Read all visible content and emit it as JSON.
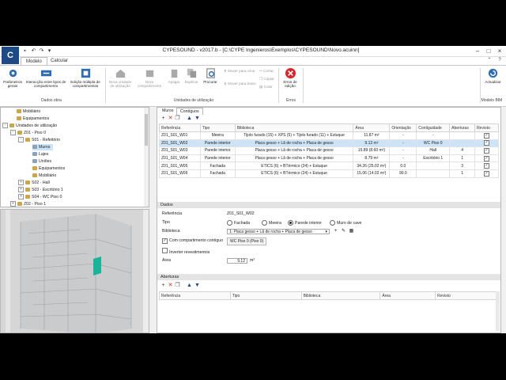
{
  "window": {
    "title": "CYPESOUND - v2017.b - [C:\\CYPE Ingenieros\\Exemplos\\CYPESOUND\\Novo.acuinn]",
    "logo": "C"
  },
  "ribbon_tabs": [
    "Modelo",
    "Calcular"
  ],
  "ribbon": {
    "groups": {
      "dados_obra": {
        "label": "Dados obra",
        "buttons": [
          {
            "label": "Parâmetros gerais",
            "icon": "gear-icon"
          },
          {
            "label": "Interacção entre tipos de compartimento",
            "icon": "arrows-icon"
          },
          {
            "label": "Edição múltipla de compartimentos",
            "icon": "multi-edit-icon"
          }
        ]
      },
      "unidades_utilizacao": {
        "label": "Unidades de utilização",
        "buttons": [
          {
            "label": "Nova unidade de utilização",
            "icon": "house-icon"
          },
          {
            "label": "Novo compartimento",
            "icon": "room-icon"
          },
          {
            "label": "Apagar",
            "icon": "delete-icon"
          },
          {
            "label": "Duplicar",
            "icon": "duplicate-icon"
          },
          {
            "label": "Procurar",
            "icon": "search-icon"
          }
        ],
        "small": [
          "Mover para cima",
          "Mover para baixo",
          "Cortar",
          "Copiar",
          "Colar"
        ]
      },
      "erros": {
        "label": "Erros",
        "buttons": [
          {
            "label": "Erros de edição",
            "icon": "error-icon"
          }
        ]
      },
      "modelo_bim": {
        "label": "Modelo BIM",
        "buttons": [
          {
            "label": "Actualizar",
            "icon": "refresh-icon"
          }
        ]
      }
    }
  },
  "tree": {
    "nodes": [
      {
        "label": "Mobiliário"
      },
      {
        "label": "Equipamentos"
      },
      {
        "label": "Unidades de utilização"
      },
      {
        "label": "Z01 - Piso 0"
      },
      {
        "label": "S01 - Refeitório"
      },
      {
        "label": "Muros"
      },
      {
        "label": "Lajes"
      },
      {
        "label": "Uniões"
      },
      {
        "label": "Equipamentos"
      },
      {
        "label": "Mobiliário"
      },
      {
        "label": "S02 - Hall"
      },
      {
        "label": "S03 - Escritório 1"
      },
      {
        "label": "S04 - WC Piso 0"
      },
      {
        "label": "Z02 - Piso 1"
      }
    ]
  },
  "panel_tabs": [
    "Muros",
    "Contíguos"
  ],
  "walls_table": {
    "headers": [
      "Referência",
      "Tipo",
      "Biblioteca",
      "Área",
      "Orientação",
      "Contiguidade",
      "Aberturas",
      "Revisto"
    ],
    "rows": [
      {
        "ref": "Z01_S01_W01",
        "tipo": "Meeira",
        "biblioteca": "Tijolo furado (15) + XPS (5) + Tijolo furado (11) + Estuque",
        "area": "11.87 m²",
        "orientacao": "-",
        "contiguidade": "-",
        "aberturas": "",
        "revisto": "✓"
      },
      {
        "ref": "Z01_S01_W02",
        "tipo": "Parede interior",
        "biblioteca": "Placa gesso + Lã de rocha + Placa de gesso",
        "area": "9.12 m²",
        "orientacao": "-",
        "contiguidade": "WC Piso 0",
        "aberturas": "",
        "revisto": "✓"
      },
      {
        "ref": "Z01_S01_W03",
        "tipo": "Parede interior",
        "biblioteca": "Placa gesso + Lã de rocha + Placa de gesso",
        "area": "15.89 (8.60 m²)",
        "orientacao": "-",
        "contiguidade": "Hall",
        "aberturas": "4",
        "revisto": "✓"
      },
      {
        "ref": "Z01_S01_W04",
        "tipo": "Parede interior",
        "biblioteca": "Placa gesso + Lã de rocha + Placa de gesso",
        "area": "8.79 m²",
        "orientacao": "-",
        "contiguidade": "Escritório 1",
        "aberturas": "1",
        "revisto": "✓"
      },
      {
        "ref": "Z01_S01_W05",
        "tipo": "Fachada",
        "biblioteca": "ETICS (6) + BTérmico (24) + Estuque",
        "area": "34.26 (25.02 m²)",
        "orientacao": "0.0",
        "contiguidade": "",
        "aberturas": "3",
        "revisto": "✓"
      },
      {
        "ref": "Z01_S01_W06",
        "tipo": "Fachada",
        "biblioteca": "ETICS (6) + BTérmico (24) + Estuque",
        "area": "15.06 (14.02 m²)",
        "orientacao": "90.0",
        "contiguidade": "",
        "aberturas": "1",
        "revisto": "✓"
      }
    ]
  },
  "dados": {
    "title": "Dados",
    "referencia_label": "Referência",
    "referencia_value": "Z01_S01_W02",
    "tipo_label": "Tipo",
    "tipo_options": [
      "Fachada",
      "Meeira",
      "Parede interior",
      "Muro de cave"
    ],
    "tipo_selected": "Parede interior",
    "biblioteca_label": "Biblioteca",
    "biblioteca_value": "1: Placa gesso + Lã de rocha + Placa de gesso",
    "contiguo_label": "Com compartimento contíguo",
    "contiguo_value": "WC Piso 0 (Piso 0)",
    "inverter_label": "Inverter revestimentos",
    "area_label": "Área",
    "area_value": "9.12",
    "area_unit": "m²"
  },
  "aberturas": {
    "title": "Aberturas",
    "headers": [
      "Referência",
      "Tipo",
      "Biblioteca",
      "Área",
      "Revisto"
    ]
  },
  "colors": {
    "accent_blue": "#1e4a86",
    "selection": "#cde3f7",
    "error_red": "#d9262c"
  }
}
